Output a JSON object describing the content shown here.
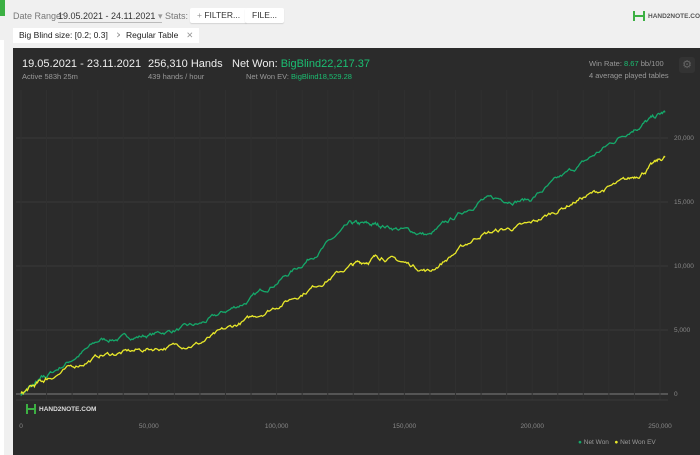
{
  "toolbar": {
    "date_range_label": "Date Range:",
    "date_range_value": "19.05.2021 - 24.11.2021",
    "stats_label": "Stats:",
    "filter_button": "FILTER...",
    "file_button": "FILE..."
  },
  "filters": [
    {
      "label": "Big Blind size: [0.2; 0.3]"
    },
    {
      "label": "Regular Table"
    }
  ],
  "brand": "HAND2NOTE.COM",
  "summary": {
    "period": "19.05.2021 - 23.11.2021",
    "active": "Active 583h 25m",
    "hands": "256,310 Hands",
    "hands_per_hour": "439 hands / hour",
    "net_won_label": "Net Won:",
    "net_won_value": "BigBlind22,217.37",
    "net_won_ev_label": "Net Won  EV:",
    "net_won_ev_value": "BigBlind18,529.28",
    "win_rate_label": "Win Rate:",
    "win_rate_value": "8.67",
    "win_rate_unit": "bb/100",
    "tables": "4 average played tables"
  },
  "colors": {
    "accent": "#1bbf72",
    "net_won": "#15a86a",
    "net_won_ev": "#e8e82a",
    "panel": "#2b2b2b"
  },
  "chart_data": {
    "type": "line",
    "xlim": [
      0,
      255000
    ],
    "ylim": [
      -500,
      24000
    ],
    "x_ticks": [
      "0",
      "50,000",
      "100,000",
      "150,000",
      "200,000",
      "250,000"
    ],
    "y_ticks": [
      "0",
      "5,000",
      "10,000",
      "15,000",
      "20,000"
    ],
    "grid": true,
    "legend": "bottom-right",
    "x": [
      0,
      11000,
      31000,
      50000,
      70000,
      89000,
      109000,
      129000,
      141000,
      160000,
      180000,
      199000,
      219000,
      238000,
      252000
    ],
    "series": [
      {
        "name": "Net Won",
        "values": [
          0,
          1500,
          4200,
          4600,
          5400,
          7300,
          10000,
          13200,
          13200,
          12400,
          15200,
          15200,
          17900,
          20600,
          22000
        ]
      },
      {
        "name": "Net Won  EV",
        "values": [
          0,
          1300,
          3000,
          3500,
          4000,
          5800,
          7800,
          10000,
          10800,
          9600,
          12500,
          13200,
          15300,
          16700,
          18500
        ]
      }
    ]
  }
}
